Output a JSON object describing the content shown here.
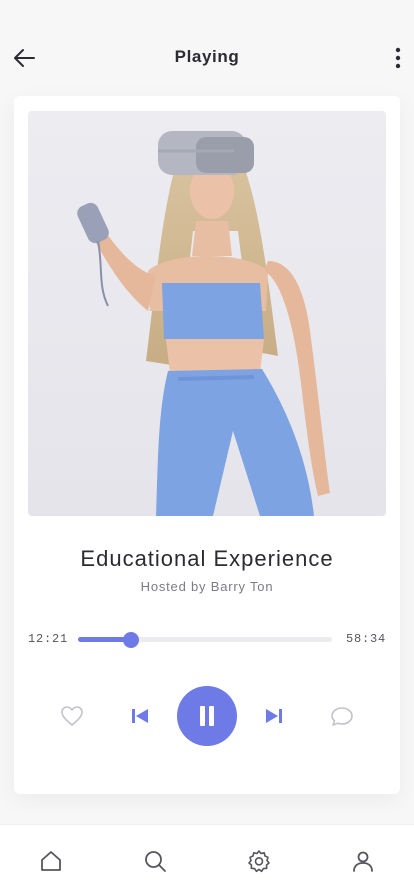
{
  "header": {
    "title": "Playing",
    "back_icon": "arrow-left-icon",
    "more_icon": "more-vertical-icon"
  },
  "track": {
    "title": "Educational Experience",
    "host": "Hosted by Barry Ton",
    "current_time": "12:21",
    "total_time": "58:34",
    "progress": 0.21
  },
  "controls": {
    "like_icon": "heart-icon",
    "prev_icon": "skip-previous-icon",
    "play_icon": "pause-icon",
    "next_icon": "skip-next-icon",
    "chat_icon": "chat-bubble-icon"
  },
  "tabbar": {
    "items": [
      {
        "icon": "home-icon"
      },
      {
        "icon": "search-icon"
      },
      {
        "icon": "settings-icon"
      },
      {
        "icon": "user-icon"
      }
    ]
  },
  "colors": {
    "accent": "#6e7ae6",
    "text": "#2b2b33",
    "muted": "#7c7c86"
  }
}
